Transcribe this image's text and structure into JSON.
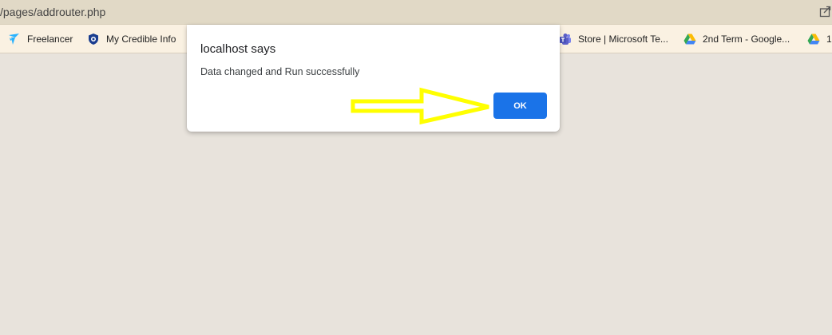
{
  "address_bar": {
    "url": "/pages/addrouter.php",
    "share_icon": "share-icon"
  },
  "bookmarks": [
    {
      "label": "Freelancer",
      "icon": "freelancer-icon",
      "color": "#29b2fe"
    },
    {
      "label": "My Credible Info",
      "icon": "shield-icon",
      "color": "#1a3d8f"
    },
    {
      "label": "Store | Microsoft Te...",
      "icon": "teams-icon",
      "color": "#5b5fc7"
    },
    {
      "label": "2nd Term - Google...",
      "icon": "google-drive-icon",
      "color": "#34a853"
    },
    {
      "label": "1",
      "icon": "google-drive-icon",
      "color": "#34a853"
    }
  ],
  "dialog": {
    "title": "localhost says",
    "message": "Data changed and Run successfully",
    "ok_label": "OK",
    "ok_color": "#1a73e8"
  },
  "annotation": {
    "type": "arrow",
    "points_to": "ok-button",
    "color": "#ffff00"
  }
}
